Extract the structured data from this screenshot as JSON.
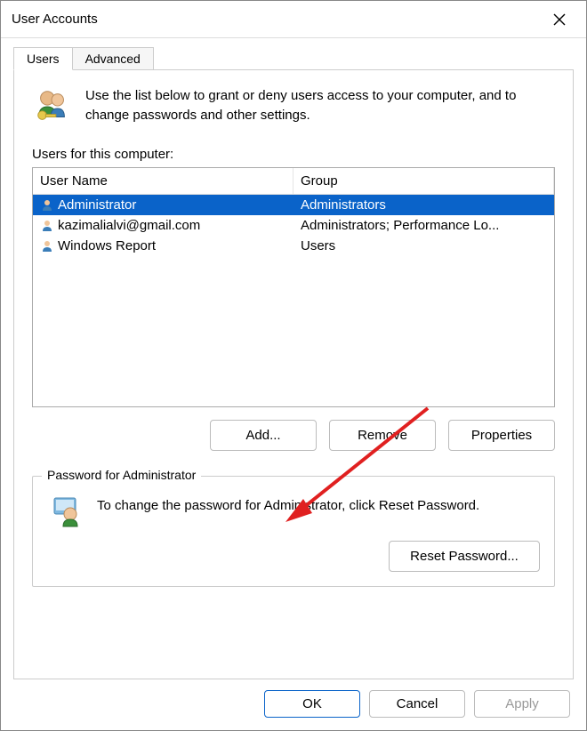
{
  "title": "User Accounts",
  "tabs": {
    "users": "Users",
    "advanced": "Advanced"
  },
  "intro": "Use the list below to grant or deny users access to your computer, and to change passwords and other settings.",
  "list_label": "Users for this computer:",
  "columns": {
    "name": "User Name",
    "group": "Group"
  },
  "rows": [
    {
      "name": "Administrator",
      "group": "Administrators",
      "selected": true
    },
    {
      "name": "kazimalialvi@gmail.com",
      "group": "Administrators; Performance Lo...",
      "selected": false
    },
    {
      "name": "Windows Report",
      "group": "Users",
      "selected": false
    }
  ],
  "buttons": {
    "add": "Add...",
    "remove": "Remove",
    "properties": "Properties"
  },
  "password_box": {
    "label": "Password for Administrator",
    "text": "To change the password for Administrator, click Reset Password.",
    "reset": "Reset Password..."
  },
  "footer": {
    "ok": "OK",
    "cancel": "Cancel",
    "apply": "Apply"
  }
}
